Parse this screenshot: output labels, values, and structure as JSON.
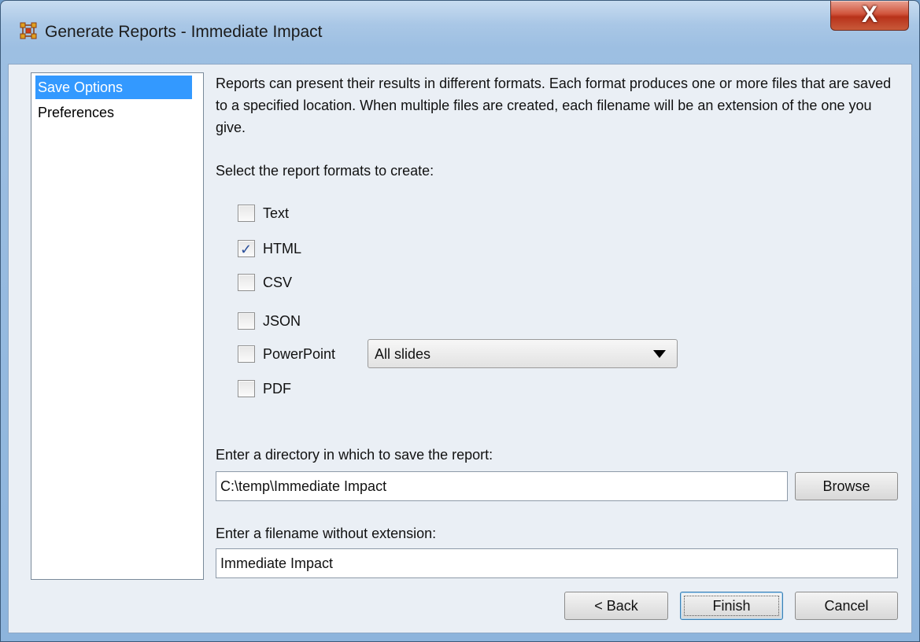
{
  "window": {
    "title": "Generate Reports - Immediate Impact",
    "close_label": "X"
  },
  "sidebar": {
    "items": [
      {
        "label": "Save Options",
        "selected": true
      },
      {
        "label": "Preferences",
        "selected": false
      }
    ]
  },
  "main": {
    "description": "Reports can present their results in different formats. Each format produces one or more files that are saved to a specified location. When multiple files are created, each filename will be an extension of the one you give.",
    "formats_prompt": "Select the report formats to create:",
    "formats": [
      {
        "label": "Text",
        "checked": false
      },
      {
        "label": "HTML",
        "checked": true
      },
      {
        "label": "CSV",
        "checked": false
      },
      {
        "label": "JSON",
        "checked": false
      },
      {
        "label": "PowerPoint",
        "checked": false
      },
      {
        "label": "PDF",
        "checked": false
      }
    ],
    "powerpoint_option": "All slides",
    "directory_prompt": "Enter a directory in which to save the report:",
    "directory_value": "C:\\temp\\Immediate Impact",
    "browse_label": "Browse",
    "filename_prompt": "Enter a filename without extension:",
    "filename_value": "Immediate Impact"
  },
  "footer": {
    "back_label": "< Back",
    "finish_label": "Finish",
    "cancel_label": "Cancel"
  },
  "colors": {
    "selection": "#3399ff",
    "checkmark": "#2b4f9a",
    "close_button": "#c8452c"
  }
}
